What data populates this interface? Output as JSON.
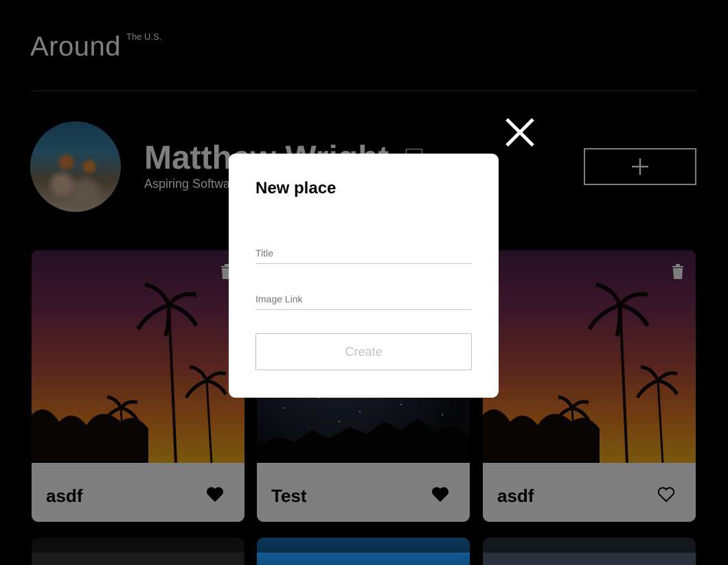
{
  "header": {
    "logo_main": "Around",
    "logo_sup": "The U.S."
  },
  "profile": {
    "name": "Matthew Wright",
    "about": "Aspiring Software Engineer",
    "edit_icon": "pencil-icon",
    "add_icon": "plus-icon"
  },
  "cards": [
    {
      "title": "asdf",
      "liked": true,
      "image": "palm-sunset"
    },
    {
      "title": "Test",
      "liked": true,
      "image": "night-sky-mountains"
    },
    {
      "title": "asdf",
      "liked": false,
      "image": "palm-sunset"
    }
  ],
  "modal": {
    "title": "New place",
    "title_placeholder": "Title",
    "title_value": "",
    "link_placeholder": "Image Link",
    "link_value": "",
    "submit_label": "Create",
    "close_icon": "close-icon"
  },
  "colors": {
    "background": "#000000",
    "card_footer": "#ffffff",
    "overlay": "rgba(0,0,0,0.5)",
    "disabled_text": "#c4c4c4"
  }
}
